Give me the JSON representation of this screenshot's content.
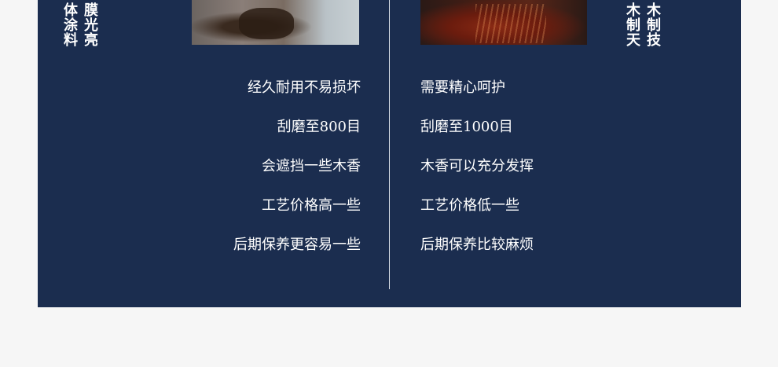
{
  "left_vertical_columns": [
    [
      "体",
      "涂",
      "料"
    ],
    [
      "膜",
      "光",
      "亮"
    ]
  ],
  "right_vertical_columns": [
    [
      "木",
      "制",
      "天"
    ],
    [
      "木",
      "制",
      "技"
    ]
  ],
  "left_items": [
    "经久耐用不易损坏",
    "刮磨至800目",
    "会遮挡一些木香",
    "工艺价格高一些",
    "后期保养更容易一些"
  ],
  "right_items": [
    "需要精心呵护",
    "刮磨至1000目",
    "木香可以充分发挥",
    "工艺价格低一些",
    "后期保养比较麻烦"
  ],
  "colors": {
    "panel": "#1b2d4f",
    "background": "#f6f6f6",
    "text": "#ffffff"
  }
}
